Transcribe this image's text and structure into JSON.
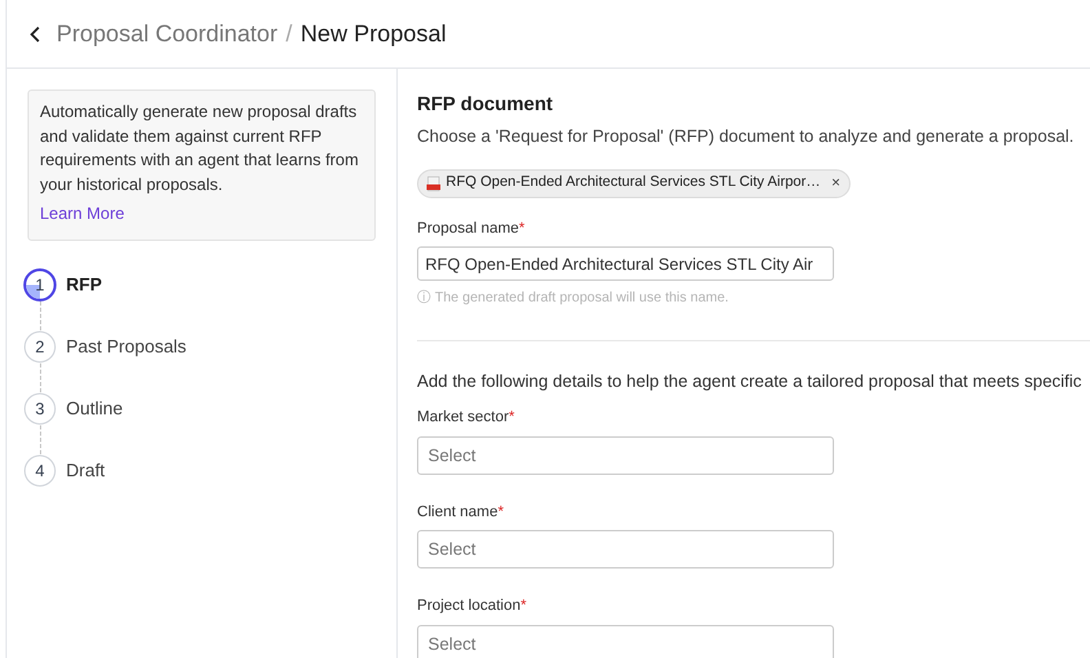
{
  "breadcrumb": {
    "parent": "Proposal Coordinator",
    "separator": "/",
    "current": "New Proposal"
  },
  "info": {
    "text": "Automatically generate new proposal drafts and validate them against current RFP requirements with an agent that learns from your historical proposals.",
    "link": "Learn More"
  },
  "steps": [
    {
      "number": "1",
      "label": "RFP",
      "selected": true
    },
    {
      "number": "2",
      "label": "Past Proposals",
      "selected": false
    },
    {
      "number": "3",
      "label": "Outline",
      "selected": false
    },
    {
      "number": "4",
      "label": "Draft",
      "selected": false
    }
  ],
  "rfp_document": {
    "title": "RFP document",
    "description": "Choose a 'Request for Proposal' (RFP) document to analyze and generate a proposal.",
    "file_chip": "RFQ Open-Ended Architectural Services STL City Airpor…",
    "remove": "×"
  },
  "proposal_name": {
    "label": "Proposal name",
    "required_mark": "*",
    "value": "RFQ Open-Ended Architectural Services STL City Air",
    "hint_icon": "ⓘ",
    "hint": "The generated draft proposal will use this name."
  },
  "details_intro": "Add the following details to help the agent create a tailored proposal that meets specific",
  "detail_fields": [
    {
      "label": "Market sector",
      "required_mark": "*",
      "placeholder": "Select"
    },
    {
      "label": "Client name",
      "required_mark": "*",
      "placeholder": "Select"
    },
    {
      "label": "Project location",
      "required_mark": "*",
      "placeholder": "Select"
    }
  ]
}
